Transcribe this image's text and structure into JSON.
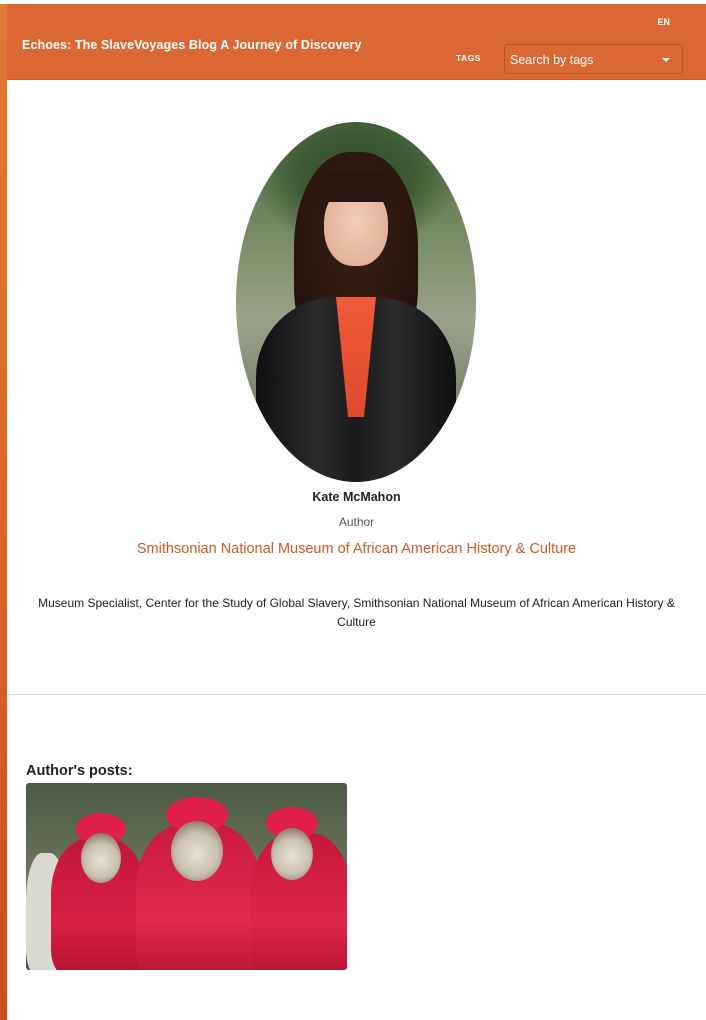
{
  "header": {
    "site_title": "Echoes: The SlaveVoyages Blog A Journey of Discovery",
    "language": "EN",
    "tags_label": "TAGS",
    "tags_select_value": "Search by tags",
    "accent_color": "#db6834"
  },
  "author": {
    "name": "Kate McMahon",
    "role": "Author",
    "institution": "Smithsonian National Museum of African American History & Culture",
    "bio": "Museum Specialist, Center for the Study of Global Slavery, Smithsonian National Museum of African American History & Culture"
  },
  "posts": {
    "heading": "Author's posts:"
  },
  "icons": {
    "dropdown": "chevron-down-icon"
  }
}
